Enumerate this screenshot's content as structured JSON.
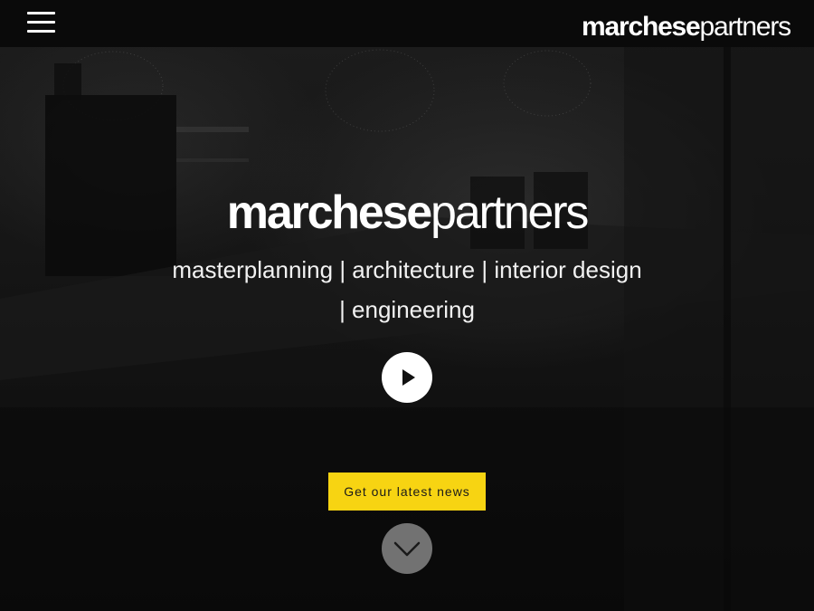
{
  "header": {
    "logo_bold": "marchese",
    "logo_light": "partners"
  },
  "hero": {
    "logo_bold": "marchese",
    "logo_light": "partners",
    "tagline_line1": "masterplanning | architecture | interior design",
    "tagline_line2": "| engineering",
    "news_button_label": "Get our latest news"
  },
  "icons": {
    "menu": "hamburger-menu-icon",
    "play": "play-icon",
    "scroll": "chevron-down-icon"
  },
  "colors": {
    "accent": "#f7d412",
    "topbar": "#0a0a0a",
    "text": "#ffffff"
  }
}
